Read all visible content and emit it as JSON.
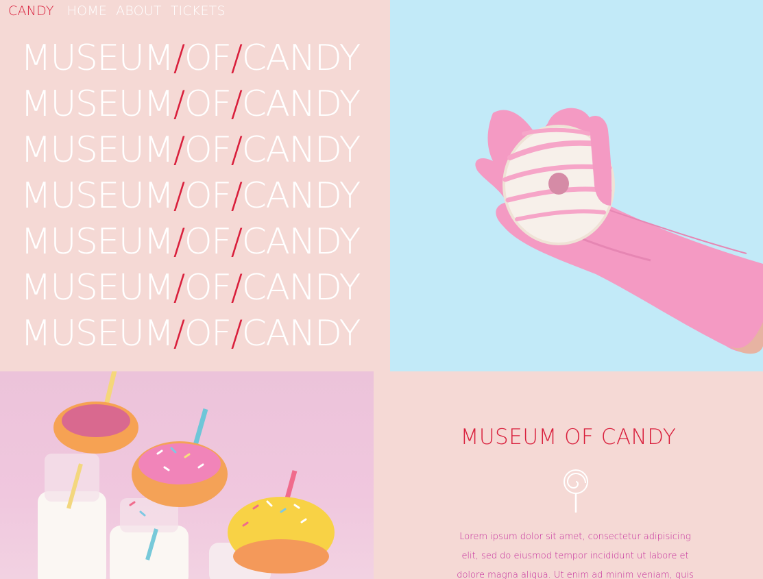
{
  "nav": {
    "brand": "CANDY",
    "items": [
      "HOME",
      "ABOUT",
      "TICKETS"
    ]
  },
  "hero": {
    "lines": [
      {
        "w1": "MUSEUM",
        "s1": "/",
        "w2": "OF",
        "s2": "/",
        "w3": "CANDY"
      },
      {
        "w1": "MUSEUM",
        "s1": "/",
        "w2": "OF",
        "s2": "/",
        "w3": "CANDY"
      },
      {
        "w1": "MUSEUM",
        "s1": "/",
        "w2": "OF",
        "s2": "/",
        "w3": "CANDY"
      },
      {
        "w1": "MUSEUM",
        "s1": "/",
        "w2": "OF",
        "s2": "/",
        "w3": "CANDY"
      },
      {
        "w1": "MUSEUM",
        "s1": "/",
        "w2": "OF",
        "s2": "/",
        "w3": "CANDY"
      },
      {
        "w1": "MUSEUM",
        "s1": "/",
        "w2": "OF",
        "s2": "/",
        "w3": "CANDY"
      },
      {
        "w1": "MUSEUM",
        "s1": "/",
        "w2": "OF",
        "s2": "/",
        "w3": "CANDY"
      }
    ]
  },
  "info": {
    "title": "MUSEUM OF CANDY",
    "icon": "lollipop-icon",
    "text": "Lorem ipsum dolor sit amet, consectetur adipisicing elit, sed do eiusmod tempor incididunt ut labore et dolore magna aliqua. Ut enim ad minim veniam, quis nostrud"
  },
  "colors": {
    "accent": "#d91f3c",
    "pink_bg": "#f5d9d5",
    "blue_bg": "#c2eaf8",
    "text_magenta": "#c3279a"
  }
}
